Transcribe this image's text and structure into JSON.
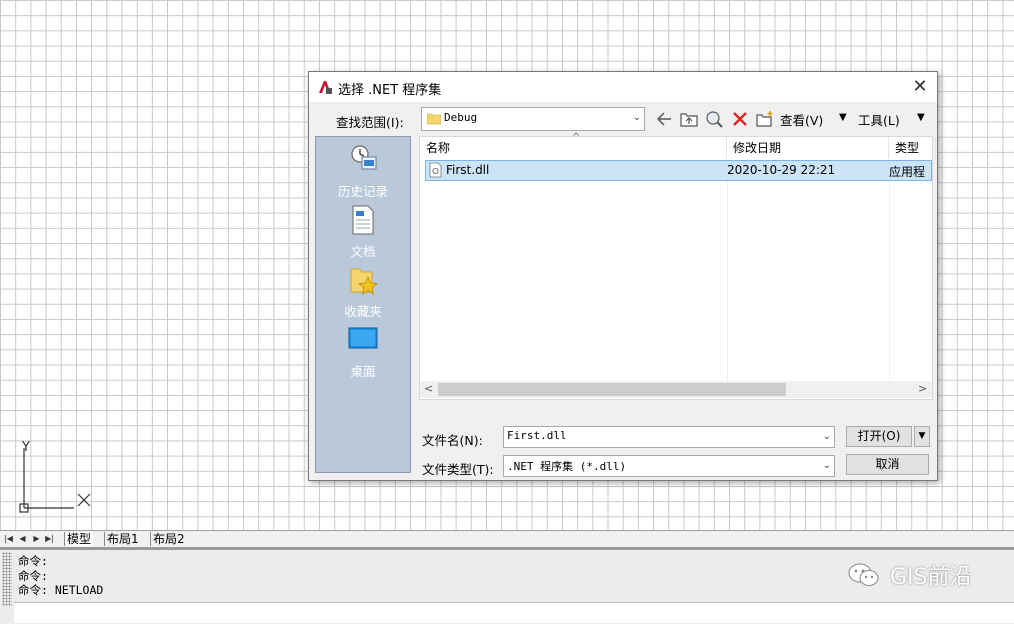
{
  "dialog": {
    "title": "选择 .NET 程序集",
    "look_in_label": "查找范围(I):",
    "look_in_value": "Debug",
    "toolbar": {
      "view_label": "查看(V)",
      "tools_label": "工具(L)"
    },
    "places": [
      {
        "label": "历史记录",
        "icon": "history-icon"
      },
      {
        "label": "文档",
        "icon": "document-icon"
      },
      {
        "label": "收藏夹",
        "icon": "favorites-icon"
      },
      {
        "label": "桌面",
        "icon": "desktop-icon"
      }
    ],
    "columns": {
      "name": "名称",
      "modified": "修改日期",
      "type": "类型"
    },
    "files": [
      {
        "name": "First.dll",
        "modified": "2020-10-29 22:21",
        "type": "应用程"
      }
    ],
    "filename_label": "文件名(N):",
    "filename_value": "First.dll",
    "filetype_label": "文件类型(T):",
    "filetype_value": ".NET 程序集 (*.dll)",
    "open_label": "打开(O)",
    "cancel_label": "取消"
  },
  "canvas": {
    "ucs_y": "Y"
  },
  "layout_tabs": [
    "模型",
    "布局1",
    "布局2"
  ],
  "command": {
    "history": [
      "命令:",
      "命令:",
      "命令: NETLOAD"
    ]
  },
  "watermark": "GIS前沿"
}
